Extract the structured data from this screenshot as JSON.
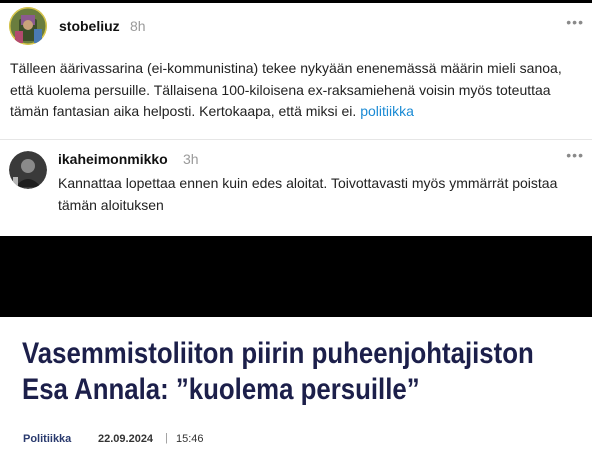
{
  "posts": [
    {
      "username": "stobeliuz",
      "time": "8h",
      "more": "•••",
      "text": "Tälleen äärivassarina (ei-kommunistina) tekee nykyään enenemässä määrin mieli sanoa, että kuolema persuille. Tällaisena 100-kiloisena ex-raksamiehenä voisin myös toteuttaa tämän fantasian aika helposti. Kertokaapa, että miksi ei.",
      "tag": "politiikka"
    },
    {
      "username": "ikaheimonmikko",
      "time": "3h",
      "more": "•••",
      "text": "Kannattaa lopettaa ennen kuin edes aloitat. Toivottavasti myös ymmärrät poistaa tämän aloituksen"
    }
  ],
  "article": {
    "headline_line1": "Vasemmistoliiton piirin puheenjohtajiston",
    "headline_line2": "Esa Annala: ”kuolema persuille”",
    "category": "Politiikka",
    "date": "22.09.2024",
    "separator": "|",
    "time": "15:46"
  },
  "colors": {
    "tag": "#1a8ad4",
    "headline": "#1c1f4a",
    "category": "#2a3a6e"
  }
}
